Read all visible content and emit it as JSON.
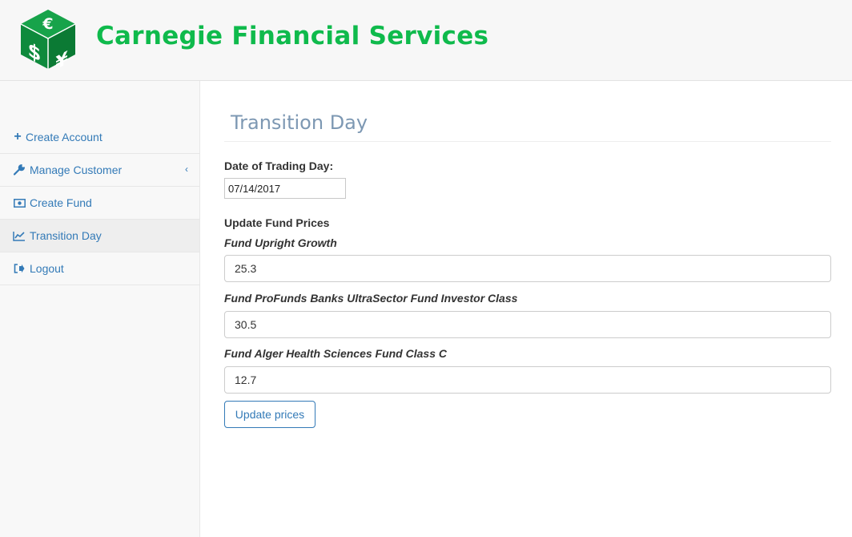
{
  "header": {
    "brand_title": "Carnegie Financial Services",
    "logo_icon": "currency-cube-icon",
    "brand_color": "#0fba4c"
  },
  "sidebar": {
    "items": [
      {
        "label": "Create Account",
        "icon": "plus-icon"
      },
      {
        "label": "Manage Customer",
        "icon": "wrench-icon",
        "chevron": "‹"
      },
      {
        "label": "Create Fund",
        "icon": "money-icon"
      },
      {
        "label": "Transition Day",
        "icon": "line-chart-icon",
        "active": true
      },
      {
        "label": "Logout",
        "icon": "sign-out-icon"
      }
    ]
  },
  "main": {
    "title": "Transition Day",
    "date_label": "Date of Trading Day:",
    "date_value": "07/14/2017",
    "section_label": "Update Fund Prices",
    "funds": [
      {
        "name": "Fund Upright Growth",
        "price": "25.3"
      },
      {
        "name": "Fund ProFunds Banks UltraSector Fund Investor Class",
        "price": "30.5"
      },
      {
        "name": "Fund Alger Health Sciences Fund Class C",
        "price": "12.7"
      }
    ],
    "submit_label": "Update prices"
  },
  "colors": {
    "link": "#337ab7",
    "title": "#7d98b3",
    "sidebar_bg": "#f8f8f8"
  }
}
